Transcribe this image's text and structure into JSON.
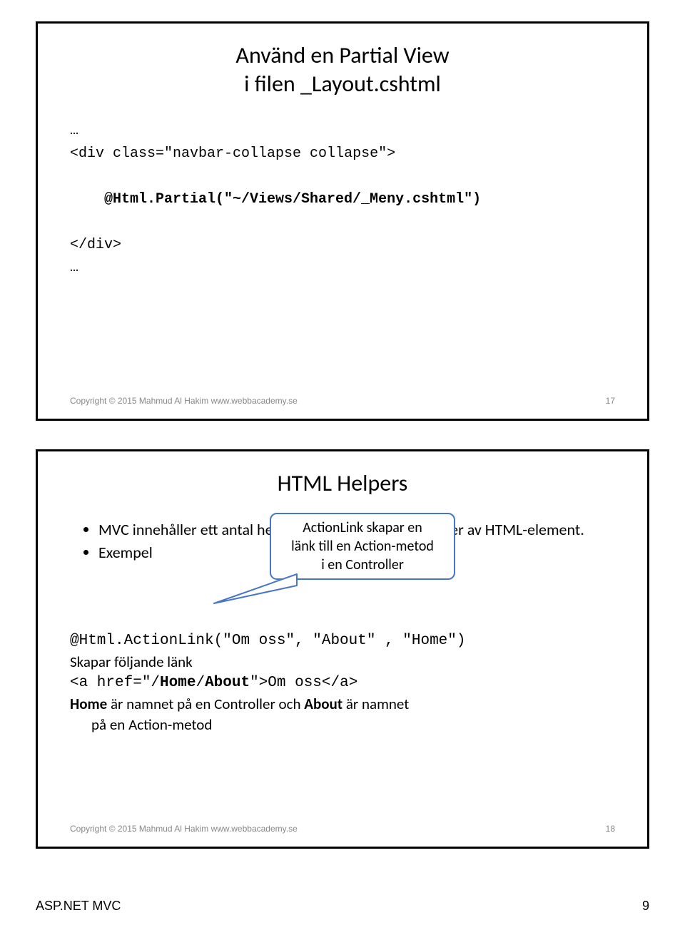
{
  "slide1": {
    "title_line1": "Använd en Partial View",
    "title_line2": "i filen _Layout.cshtml",
    "code_l1": "…",
    "code_l2": "<div class=\"navbar-collapse collapse\">",
    "code_l3": "@Html.Partial(\"~/Views/Shared/_Meny.cshtml\")",
    "code_l4": "</div>",
    "code_l5": "…",
    "copyright": "Copyright © 2015 Mahmud Al Hakim www.webbacademy.se",
    "slide_num": "17"
  },
  "slide2": {
    "title": "HTML Helpers",
    "bullet1": "MVC innehåller ett antal helpers till de mest vanliga typer av HTML-element.",
    "bullet2": "Exempel",
    "callout_l1": "ActionLink skapar en",
    "callout_l2": "länk till en Action-metod",
    "callout_l3": "i en Controller",
    "code_line": "@Html.ActionLink(\"Om oss\", \"About\" , \"Home\")",
    "result_l1": "Skapar följande länk",
    "result_l2_pre": "<a href=\"/",
    "result_l2_home": "Home",
    "result_l2_slash": "/",
    "result_l2_about": "About",
    "result_l2_post": "\">Om oss</a>",
    "result_l3_home": "Home",
    "result_l3_mid": " är namnet på en Controller och ",
    "result_l3_about": "About",
    "result_l3_tail": " är namnet",
    "result_l4": "på en Action-metod",
    "copyright": "Copyright © 2015 Mahmud Al Hakim www.webbacademy.se",
    "slide_num": "18"
  },
  "handout": {
    "left": "ASP.NET MVC",
    "right": "9"
  }
}
